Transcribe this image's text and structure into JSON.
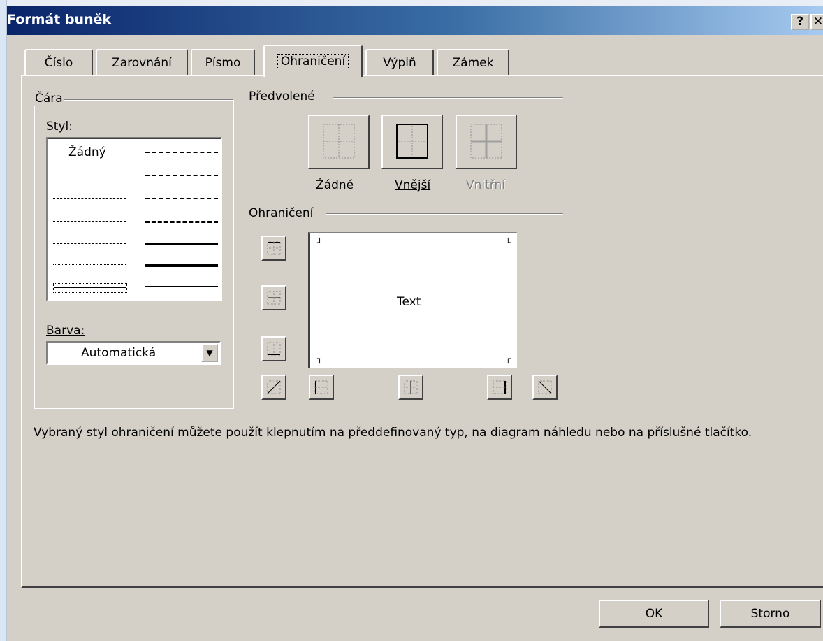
{
  "window": {
    "title": "Formát buněk",
    "help_label": "?",
    "close_label": "✕"
  },
  "tabs": [
    {
      "label": "Číslo"
    },
    {
      "label": "Zarovnání"
    },
    {
      "label": "Písmo"
    },
    {
      "label": "Ohraničení",
      "active": true
    },
    {
      "label": "Výplň"
    },
    {
      "label": "Zámek"
    }
  ],
  "line_group": {
    "title": "Čára",
    "style_label": "Styl:",
    "none_label": "Žádný",
    "color_label": "Barva:",
    "color_value": "Automatická"
  },
  "presets": {
    "title": "Předvolené",
    "none_label": "Žádné",
    "outline_label": "Vnější",
    "inside_label": "Vnitřní"
  },
  "border": {
    "title": "Ohraničení",
    "preview_text": "Text"
  },
  "hint_text": "Vybraný styl ohraničení můžete použít klepnutím na předdefinovaný typ, na diagram náhledu nebo na příslušné tlačítko.",
  "buttons": {
    "ok": "OK",
    "cancel": "Storno"
  },
  "colors": {
    "dialog_bg": "#d4d0c8",
    "title_start": "#0a246a",
    "title_end": "#a6caf0"
  }
}
